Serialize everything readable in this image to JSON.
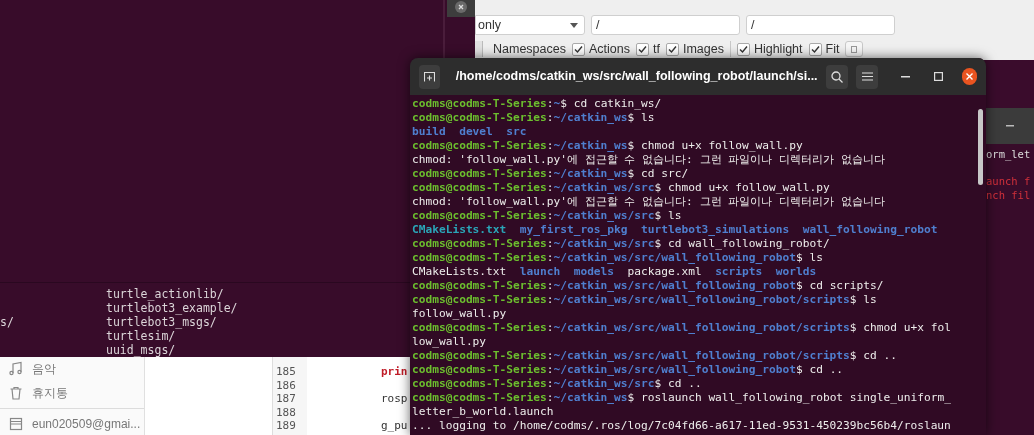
{
  "back_terminal": {
    "rows": [
      {
        "column_2": "turtle_actionlib/"
      },
      {
        "column_2": "turtlebot3_example/"
      },
      {
        "column_1": "s/",
        "column_2": "turtlebot3_msgs/"
      },
      {
        "column_2": "turtlesim/"
      },
      {
        "column_2": "uuid_msgs/"
      }
    ]
  },
  "graph_window": {
    "filter": "only",
    "fields": [
      "/",
      "/"
    ],
    "options": [
      {
        "label": "Namespaces"
      },
      {
        "label": "Actions",
        "checked": true
      },
      {
        "label": "tf",
        "checked": true
      },
      {
        "label": "Images",
        "checked": true,
        "divider_after": true
      },
      {
        "label": "Highlight",
        "checked": true
      },
      {
        "label": "Fit",
        "checked": true
      }
    ]
  },
  "file_manager": {
    "sidebar": [
      {
        "label": "음악",
        "kind": "music"
      },
      {
        "label": "휴지통",
        "kind": "trash"
      },
      {
        "label": "eun020509@gmai...",
        "kind": "drive",
        "divider_before": true
      }
    ]
  },
  "editor": {
    "lines": [
      {
        "number": "185",
        "code": "prin",
        "kind": "keyword"
      },
      {
        "number": "186"
      },
      {
        "number": "187",
        "code": "rosp",
        "kind": "plain"
      },
      {
        "number": "188"
      },
      {
        "number": "189",
        "code": "g_pu",
        "kind": "plain"
      }
    ]
  },
  "right_terminal": {
    "lines": [
      {
        "text": "orm_let",
        "kind": "plain"
      },
      {
        "text": "aunch f",
        "kind": "error",
        "blank_before": true
      },
      {
        "text": "nch fil",
        "kind": "error"
      }
    ]
  },
  "terminal": {
    "title": "/home/codms/catkin_ws/src/wall_following_robot/launch/si...",
    "lines": [
      [
        {
          "kind": "user",
          "text": "codms@codms-T-Series"
        },
        {
          "kind": "plain",
          "text": ":"
        },
        {
          "kind": "path",
          "text": "~"
        },
        {
          "kind": "plain",
          "text": "$ cd catkin_ws/"
        }
      ],
      [
        {
          "kind": "user",
          "text": "codms@codms-T-Series"
        },
        {
          "kind": "plain",
          "text": ":"
        },
        {
          "kind": "path",
          "text": "~/catkin_ws"
        },
        {
          "kind": "plain",
          "text": "$ ls"
        }
      ],
      [
        {
          "kind": "dir",
          "text": "build  devel  src"
        }
      ],
      [
        {
          "kind": "user",
          "text": "codms@codms-T-Series"
        },
        {
          "kind": "plain",
          "text": ":"
        },
        {
          "kind": "path",
          "text": "~/catkin_ws"
        },
        {
          "kind": "plain",
          "text": "$ chmod u+x follow_wall.py"
        }
      ],
      [
        {
          "kind": "plain",
          "text": "chmod: 'follow_wall.py'에 접근할 수 없습니다: 그런 파일이나 디렉터리가 없습니다"
        }
      ],
      [
        {
          "kind": "user",
          "text": "codms@codms-T-Series"
        },
        {
          "kind": "plain",
          "text": ":"
        },
        {
          "kind": "path",
          "text": "~/catkin_ws"
        },
        {
          "kind": "plain",
          "text": "$ cd src/"
        }
      ],
      [
        {
          "kind": "user",
          "text": "codms@codms-T-Series"
        },
        {
          "kind": "plain",
          "text": ":"
        },
        {
          "kind": "path",
          "text": "~/catkin_ws/src"
        },
        {
          "kind": "plain",
          "text": "$ chmod u+x follow_wall.py"
        }
      ],
      [
        {
          "kind": "plain",
          "text": "chmod: 'follow_wall.py'에 접근할 수 없습니다: 그런 파일이나 디렉터리가 없습니다"
        }
      ],
      [
        {
          "kind": "user",
          "text": "codms@codms-T-Series"
        },
        {
          "kind": "plain",
          "text": ":"
        },
        {
          "kind": "path",
          "text": "~/catkin_ws/src"
        },
        {
          "kind": "plain",
          "text": "$ ls"
        }
      ],
      [
        {
          "kind": "cyan",
          "text": "CMakeLists.txt"
        },
        {
          "kind": "dir",
          "text": "  my_first_ros_pkg  turtlebot3_simulations  wall_following_robot"
        }
      ],
      [
        {
          "kind": "user",
          "text": "codms@codms-T-Series"
        },
        {
          "kind": "plain",
          "text": ":"
        },
        {
          "kind": "path",
          "text": "~/catkin_ws/src"
        },
        {
          "kind": "plain",
          "text": "$ cd wall_following_robot/"
        }
      ],
      [
        {
          "kind": "user",
          "text": "codms@codms-T-Series"
        },
        {
          "kind": "plain",
          "text": ":"
        },
        {
          "kind": "path",
          "text": "~/catkin_ws/src/wall_following_robot"
        },
        {
          "kind": "plain",
          "text": "$ ls"
        }
      ],
      [
        {
          "kind": "plain",
          "text": "CMakeLists.txt  "
        },
        {
          "kind": "dir",
          "text": "launch  models"
        },
        {
          "kind": "plain",
          "text": "  package.xml  "
        },
        {
          "kind": "dir",
          "text": "scripts  worlds"
        }
      ],
      [
        {
          "kind": "user",
          "text": "codms@codms-T-Series"
        },
        {
          "kind": "plain",
          "text": ":"
        },
        {
          "kind": "path",
          "text": "~/catkin_ws/src/wall_following_robot"
        },
        {
          "kind": "plain",
          "text": "$ cd scripts/"
        }
      ],
      [
        {
          "kind": "user",
          "text": "codms@codms-T-Series"
        },
        {
          "kind": "plain",
          "text": ":"
        },
        {
          "kind": "path",
          "text": "~/catkin_ws/src/wall_following_robot/scripts"
        },
        {
          "kind": "plain",
          "text": "$ ls"
        }
      ],
      [
        {
          "kind": "plain",
          "text": "follow_wall.py"
        }
      ],
      [
        {
          "kind": "user",
          "text": "codms@codms-T-Series"
        },
        {
          "kind": "plain",
          "text": ":"
        },
        {
          "kind": "path",
          "text": "~/catkin_ws/src/wall_following_robot/scripts"
        },
        {
          "kind": "plain",
          "text": "$ chmod u+x fol"
        }
      ],
      [
        {
          "kind": "plain",
          "text": "low_wall.py"
        }
      ],
      [
        {
          "kind": "user",
          "text": "codms@codms-T-Series"
        },
        {
          "kind": "plain",
          "text": ":"
        },
        {
          "kind": "path",
          "text": "~/catkin_ws/src/wall_following_robot/scripts"
        },
        {
          "kind": "plain",
          "text": "$ cd .."
        }
      ],
      [
        {
          "kind": "user",
          "text": "codms@codms-T-Series"
        },
        {
          "kind": "plain",
          "text": ":"
        },
        {
          "kind": "path",
          "text": "~/catkin_ws/src/wall_following_robot"
        },
        {
          "kind": "plain",
          "text": "$ cd .."
        }
      ],
      [
        {
          "kind": "user",
          "text": "codms@codms-T-Series"
        },
        {
          "kind": "plain",
          "text": ":"
        },
        {
          "kind": "path",
          "text": "~/catkin_ws/src"
        },
        {
          "kind": "plain",
          "text": "$ cd .."
        }
      ],
      [
        {
          "kind": "user",
          "text": "codms@codms-T-Series"
        },
        {
          "kind": "plain",
          "text": ":"
        },
        {
          "kind": "path",
          "text": "~/catkin_ws"
        },
        {
          "kind": "plain",
          "text": "$ roslaunch wall_following_robot single_uniform_"
        }
      ],
      [
        {
          "kind": "plain",
          "text": "letter_b_world.launch"
        }
      ],
      [
        {
          "kind": "plain",
          "text": "... logging to /home/codms/.ros/log/7c04fd66-a617-11ed-9531-450239bc56b4/roslaun"
        }
      ]
    ]
  }
}
